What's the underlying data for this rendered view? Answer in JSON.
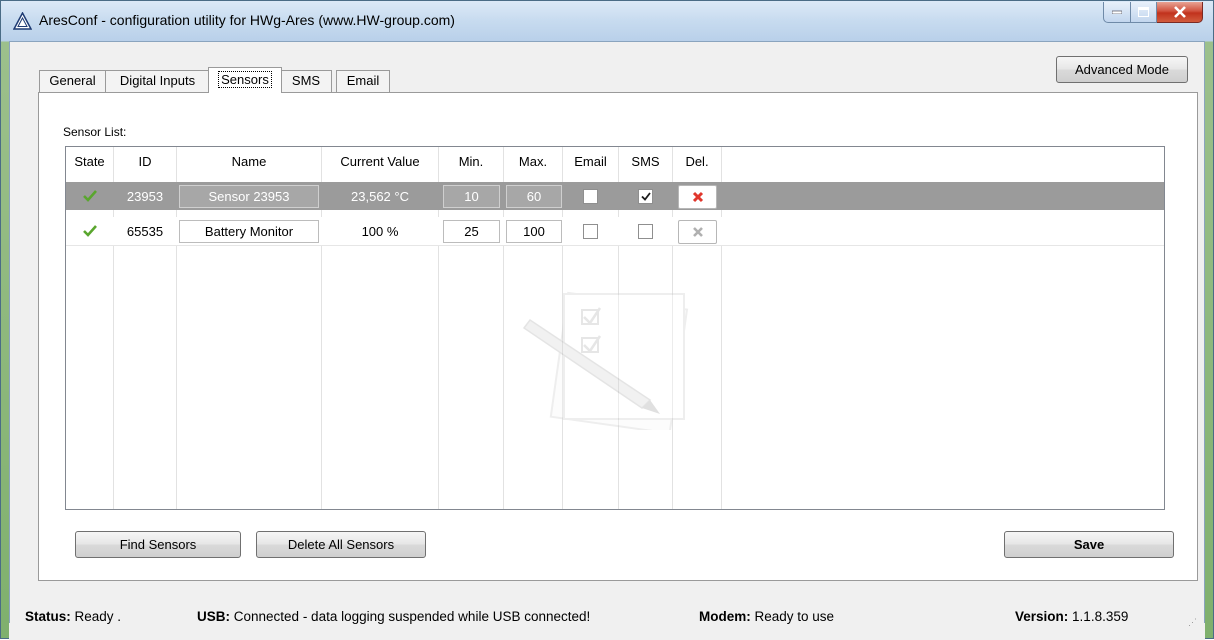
{
  "window": {
    "title": "AresConf - configuration utility for HWg-Ares (www.HW-group.com)"
  },
  "tabs": [
    {
      "label": "General"
    },
    {
      "label": "Digital Inputs"
    },
    {
      "label": "Sensors"
    },
    {
      "label": "SMS"
    },
    {
      "label": "Email"
    }
  ],
  "active_tab": "Sensors",
  "advanced_mode_label": "Advanced Mode",
  "sensor_list_label": "Sensor List:",
  "columns": [
    "State",
    "ID",
    "Name",
    "Current Value",
    "Min.",
    "Max.",
    "Email",
    "SMS",
    "Del."
  ],
  "rows": [
    {
      "state": "ok",
      "id": "23953",
      "name": "Sensor 23953",
      "current_value": "23,562 °C",
      "min": "10",
      "max": "60",
      "email": false,
      "sms": true,
      "selected": true
    },
    {
      "state": "ok",
      "id": "65535",
      "name": "Battery Monitor",
      "current_value": "100 %",
      "min": "25",
      "max": "100",
      "email": false,
      "sms": false,
      "selected": false
    }
  ],
  "buttons": {
    "find": "Find Sensors",
    "delete_all": "Delete All Sensors",
    "save": "Save"
  },
  "status": {
    "status_label": "Status:",
    "status_value": "Ready .",
    "usb_label": "USB:",
    "usb_value": "Connected - data logging suspended while USB connected!",
    "modem_label": "Modem:",
    "modem_value": "Ready to use",
    "version_label": "Version:",
    "version_value": "1.1.8.359"
  },
  "icons": {
    "app": "triangle-warning-icon",
    "state_ok": "green-check-icon",
    "delete": "red-x-icon"
  },
  "colors": {
    "selected_row": "#9b9b9b",
    "check_green": "#5aa62e",
    "delete_red": "#e0362c",
    "delete_disabled": "#b0b0b0"
  }
}
